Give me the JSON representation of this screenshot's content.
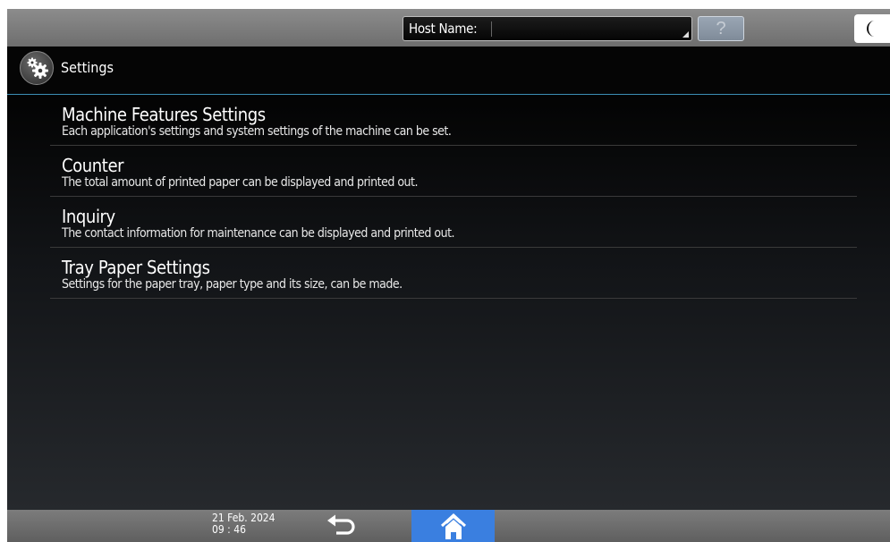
{
  "topbar": {
    "host_label": "Host Name:",
    "host_value": "",
    "help_label": "?"
  },
  "header": {
    "title": "Settings",
    "icon": "gear-icon"
  },
  "menu": {
    "items": [
      {
        "title": "Machine Features Settings",
        "description": "Each application's settings and system settings of the machine can be set."
      },
      {
        "title": "Counter",
        "description": "The total amount of printed paper can be displayed and printed out."
      },
      {
        "title": "Inquiry",
        "description": "The contact information for maintenance can be displayed and printed out."
      },
      {
        "title": "Tray Paper Settings",
        "description": "Settings for the paper tray, paper type and its size, can be made."
      }
    ]
  },
  "footer": {
    "date": "21 Feb. 2024",
    "time": "09 : 46",
    "back_icon": "back-arrow-icon",
    "home_icon": "home-icon"
  },
  "colors": {
    "accent_line": "#3d8fb5",
    "home_button": "#3a7fe0"
  }
}
